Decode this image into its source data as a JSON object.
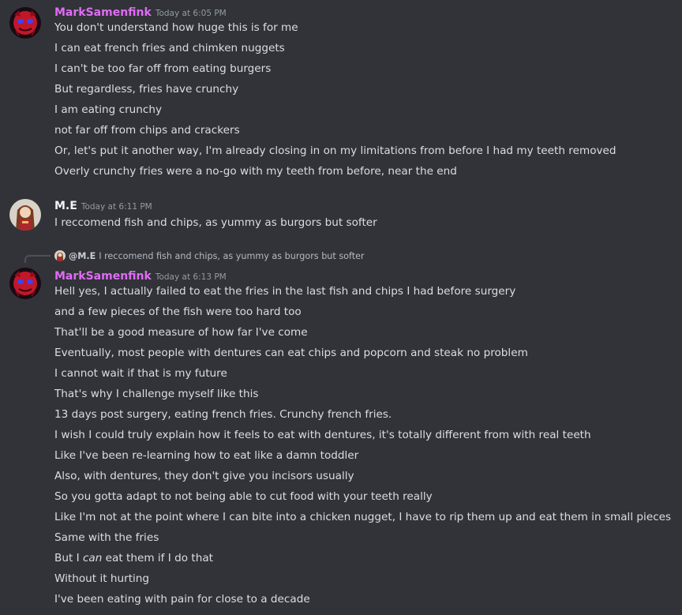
{
  "colors": {
    "background": "#313338",
    "text": "#dbdee1",
    "timestamp": "#949ba4",
    "mark_name": "#e06cf5",
    "me_name": "#f2f3f5"
  },
  "messages": [
    {
      "username": "MarkSamenfink",
      "timestamp": "Today at 6:05 PM",
      "avatar_icon": "red-mask-avatar-icon",
      "lines": [
        "You don't understand how huge this is for me",
        "I can eat french fries and chimken nuggets",
        "I can't be too far off from eating burgers",
        "But regardless, fries have crunchy",
        "I am eating crunchy",
        "not far off from chips and crackers",
        "Or, let's put it another way, I'm already closing in on my limitations from before I had my teeth removed",
        "Overly crunchy fries were a no-go with my teeth from before, near the end"
      ]
    },
    {
      "username": "M.E",
      "timestamp": "Today at 6:11 PM",
      "avatar_icon": "anime-character-avatar-icon",
      "lines": [
        "I reccomend fish and chips, as yummy as burgors but softer"
      ]
    },
    {
      "reply": {
        "name": "@M.E",
        "text": "I reccomend fish and chips, as yummy as burgors but softer"
      },
      "username": "MarkSamenfink",
      "timestamp": "Today at 6:13 PM",
      "avatar_icon": "red-mask-avatar-icon",
      "lines": [
        "Hell yes, I actually failed to eat the fries in the last fish and chips I had before surgery",
        "and a few pieces of the fish were too hard too",
        "That'll be a good measure of how far I've come",
        "Eventually, most people with dentures can eat chips and popcorn and steak no problem",
        "I cannot wait if that is my future",
        "That's why I challenge myself like this",
        "13 days post surgery, eating french fries. Crunchy french fries.",
        "I wish I could truly explain how it feels to eat with dentures, it's totally different from with real teeth",
        "Like I've been re-learning how to eat like a damn toddler",
        "Also, with dentures, they don't give you incisors usually",
        "So you gotta adapt to not being able to cut food with your teeth really",
        "Like I'm not at the point where I can bite into a chicken nugget, I have to rip them up and eat them in small pieces",
        "Same with the fries",
        {
          "pre": "But I ",
          "em": "can",
          "post": " eat them if I do that"
        },
        "Without it hurting",
        "I've been eating with pain for close to a decade"
      ]
    }
  ]
}
